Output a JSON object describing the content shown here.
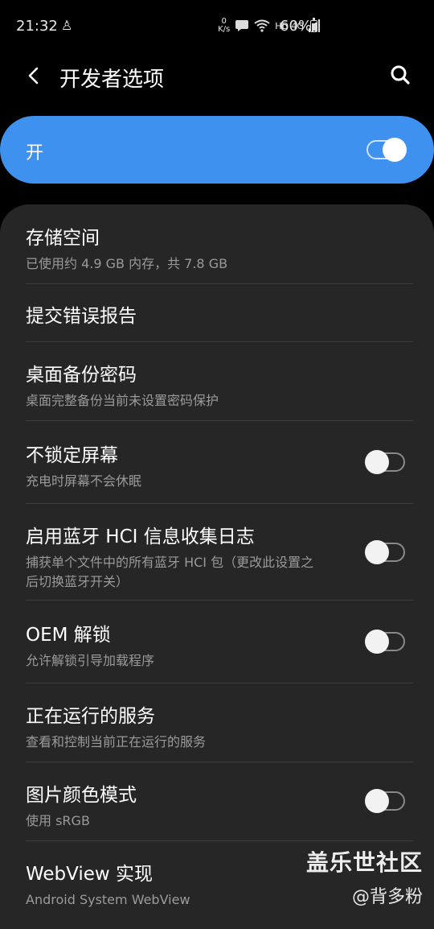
{
  "status_bar": {
    "time": "21:32",
    "net_speed_value": "0",
    "net_speed_unit": "K/s",
    "network_label": "HD 4G",
    "battery": "60%"
  },
  "app_bar": {
    "title": "开发者选项"
  },
  "master_switch": {
    "label": "开",
    "on": true
  },
  "settings": [
    {
      "title": "存储空间",
      "summary": "已使用约 4.9 GB 内存，共 7.8 GB"
    },
    {
      "title": "提交错误报告"
    },
    {
      "title": "桌面备份密码",
      "summary": "桌面完整备份当前未设置密码保护"
    },
    {
      "title": "不锁定屏幕",
      "summary": "充电时屏幕不会休眠",
      "toggle": false
    },
    {
      "title": "启用蓝牙 HCI 信息收集日志",
      "summary_line1": "捕获单个文件中的所有蓝牙 HCI 包（更改此设置之",
      "summary_line2": "后切换蓝牙开关）",
      "toggle": false
    },
    {
      "title": "OEM 解锁",
      "summary": "允许解锁引导加载程序",
      "toggle": false
    },
    {
      "title": "正在运行的服务",
      "summary": "查看和控制当前正在运行的服务"
    },
    {
      "title": "图片颜色模式",
      "summary": "使用 sRGB",
      "toggle": false
    },
    {
      "title": "WebView 实现",
      "summary": "Android System WebView"
    }
  ],
  "watermark": {
    "brand": "盖乐世社区",
    "author": "@背多粉"
  },
  "colors": {
    "accent": "#3e91ef",
    "card": "#262626",
    "background": "#000000"
  }
}
